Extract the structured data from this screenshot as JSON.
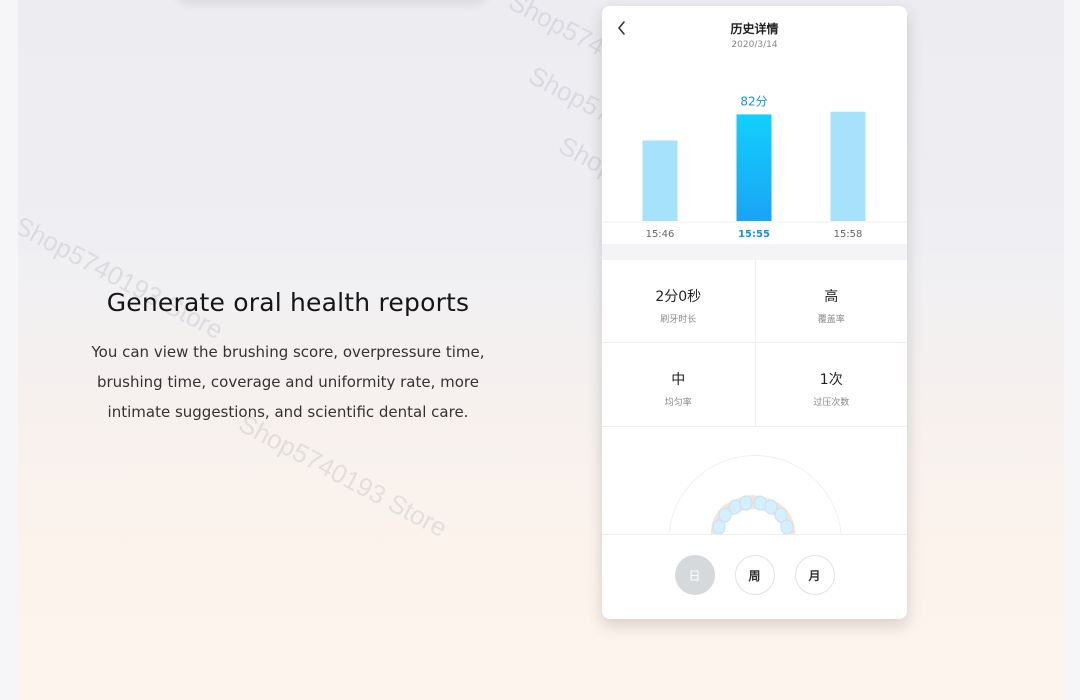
{
  "watermarks": [
    "Shop5740193 Store",
    "Shop5740193 Store",
    "Shop5740193 Store",
    "Shop5740193 Store",
    "Shop5740193 Store"
  ],
  "copy": {
    "title": "Generate oral health reports",
    "lines": [
      "You can view the brushing score, overpressure time,",
      "brushing time, coverage and uniformity rate, more",
      "intimate suggestions, and scientific dental care."
    ]
  },
  "phone": {
    "header": {
      "title": "历史详情",
      "date": "2020/3/14"
    },
    "stats": [
      {
        "value": "2分0秒",
        "label": "刷牙时长"
      },
      {
        "value": "高",
        "label": "覆盖率"
      },
      {
        "value": "中",
        "label": "均匀率"
      },
      {
        "value": "1次",
        "label": "过压次数"
      }
    ],
    "period_buttons": [
      {
        "label": "日",
        "active": true
      },
      {
        "label": "周",
        "active": false
      },
      {
        "label": "月",
        "active": false
      }
    ]
  },
  "colors": {
    "bar_light": "#a6e2fb",
    "bar_active_top": "#12d0fb",
    "bar_active_bottom": "#1aa3f5",
    "accent_text": "#1a8fe0"
  },
  "chart_data": {
    "type": "bar",
    "categories": [
      "15:46",
      "15:55",
      "15:58"
    ],
    "values": [
      62,
      82,
      84
    ],
    "selected_index": 1,
    "selected_label": "82分",
    "ylim": [
      0,
      100
    ],
    "title": "",
    "xlabel": "",
    "ylabel": "",
    "grid": false
  }
}
